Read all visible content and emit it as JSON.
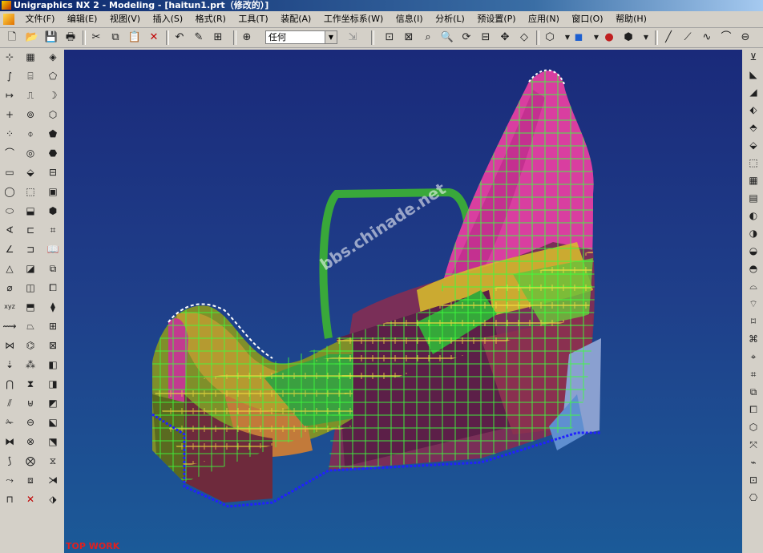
{
  "window": {
    "title": "Unigraphics NX 2 - Modeling - [haitun1.prt（修改的）]"
  },
  "menu": [
    "文件(F)",
    "编辑(E)",
    "视图(V)",
    "插入(S)",
    "格式(R)",
    "工具(T)",
    "装配(A)",
    "工作坐标系(W)",
    "信息(I)",
    "分析(L)",
    "预设置(P)",
    "应用(N)",
    "窗口(O)",
    "帮助(H)"
  ],
  "toolbar": {
    "filter_value": "任何"
  },
  "viewport": {
    "wcs_label": "TOP WORK",
    "watermark": "bbs.chinade.net"
  },
  "icons": {
    "new": "new-file-icon",
    "open": "open-folder-icon",
    "save": "save-icon",
    "print": "print-icon",
    "cut": "cut-icon",
    "copy": "copy-icon",
    "paste": "paste-icon",
    "delete": "delete-icon",
    "undo": "undo-icon",
    "edit": "edit-icon",
    "snap": "snap-icon",
    "crosshair": "select-icon"
  },
  "colors": {
    "viewport_top": "#1a2a7a",
    "viewport_bottom": "#1b5a98",
    "title_blue": "#0a246a",
    "wcs_red": "#e02020"
  }
}
